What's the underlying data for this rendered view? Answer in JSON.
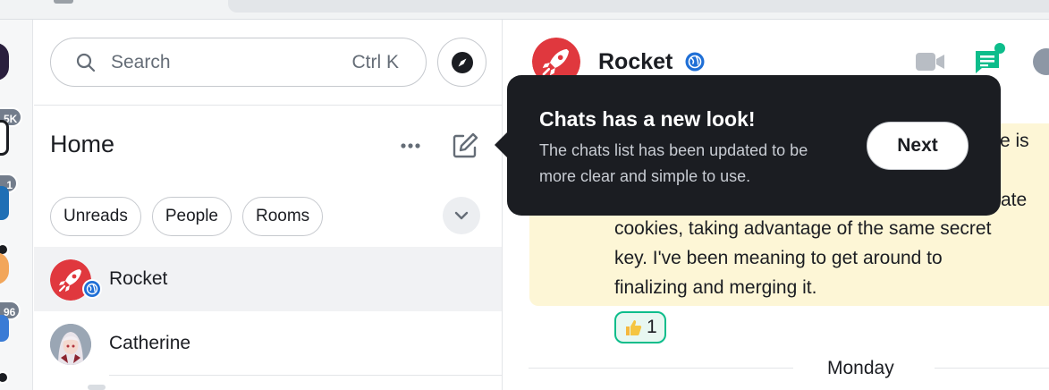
{
  "search": {
    "placeholder": "Search",
    "shortcut": "Ctrl K"
  },
  "left_panel": {
    "title": "Home",
    "filters": [
      "Unreads",
      "People",
      "Rooms"
    ],
    "rooms": [
      {
        "name": "Rocket",
        "selected": true,
        "public": true
      },
      {
        "name": "Catherine",
        "selected": false,
        "public": false
      }
    ]
  },
  "space_rail": {
    "badges": [
      "5K",
      "1",
      "96"
    ]
  },
  "room_header": {
    "name": "Rocket"
  },
  "message": {
    "lines": [
      "re is",
      "ate",
      "cookies, taking advantage of the same secret",
      "key. I've been meaning to get around to",
      "finalizing and merging it."
    ],
    "reaction": {
      "emoji": "thumbs-up",
      "count": "1"
    }
  },
  "day_separator": "Monday",
  "tooltip": {
    "title": "Chats has a new look!",
    "body": "The chats list has been updated to be more clear and simple to use.",
    "button": "Next"
  },
  "colors": {
    "accent": "#0dbd8b",
    "rocket_red": "#e0383e",
    "tooltip_bg": "#1b1d22",
    "highlight": "#fdf6d6"
  }
}
